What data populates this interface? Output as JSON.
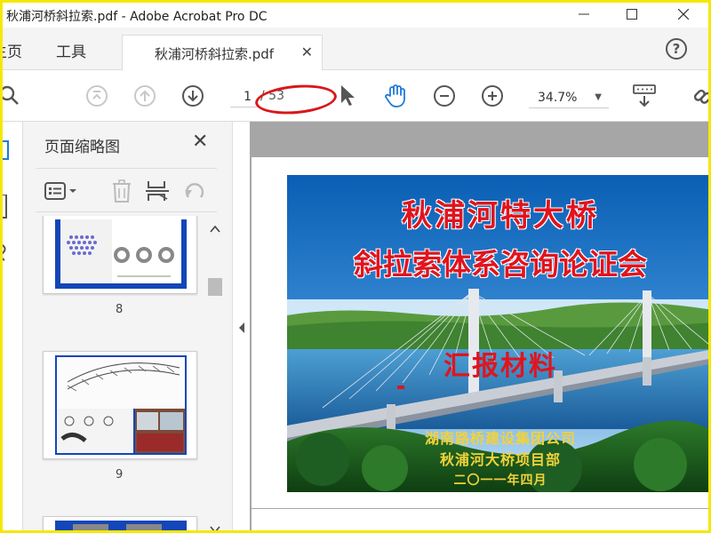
{
  "window": {
    "title": "秋浦河桥斜拉索.pdf - Adobe Acrobat Pro DC"
  },
  "tabs": {
    "home": "主页",
    "tools": "工具",
    "document": "秋浦河桥斜拉索.pdf"
  },
  "toolbar": {
    "current_page": "1",
    "page_total": "/ 53",
    "zoom": "34.7%"
  },
  "thumbnails": {
    "title": "页面缩略图",
    "pages": [
      {
        "label": "8"
      },
      {
        "label": "9"
      }
    ]
  },
  "slide": {
    "title_line1": "秋浦河特大桥",
    "title_line2": "斜拉索体系咨询论证会",
    "subtitle": "汇报材料",
    "org1": "湖南路桥建设集团公司",
    "org2": "秋浦河大桥项目部",
    "date": "二〇一一年四月"
  },
  "colors": {
    "annotation_oval": "#d8171b",
    "slide_title": "#e0141e",
    "slide_footer_text": "#f2d23a",
    "accent_blue": "#0a5fb4"
  }
}
